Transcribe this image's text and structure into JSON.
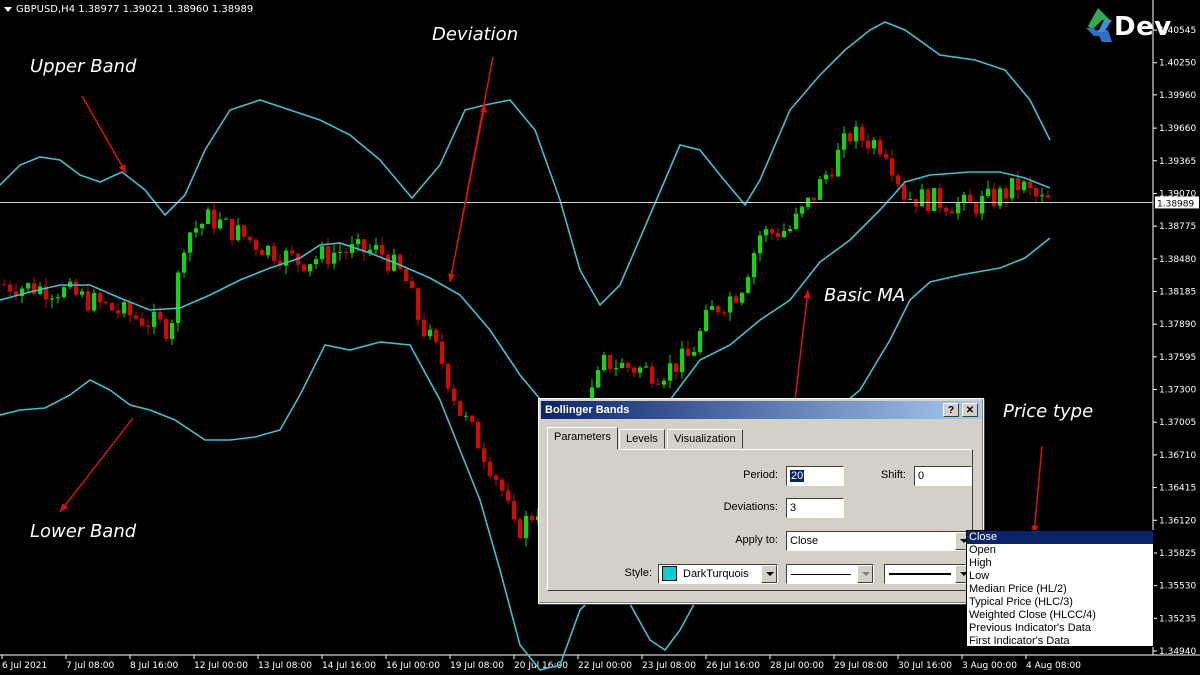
{
  "window": {
    "header": "GBPUSD,H4  1.38977 1.39021 1.38960 1.38989",
    "current_price": "1.38989"
  },
  "colors": {
    "background": "#000000",
    "bull_candle": "#00e000",
    "bear_candle": "#e00000",
    "band_line": "#3fc0d0",
    "arrow": "#e01010"
  },
  "logo": {
    "text": "Dev",
    "icon": "4x-logo-icon"
  },
  "annotations": {
    "upper_band": "Upper Band",
    "lower_band": "Lower Band",
    "deviation": "Deviation",
    "basic_ma": "Basic MA",
    "price_type": "Price type"
  },
  "chart_data": {
    "type": "candlestick",
    "symbol": "GBPUSD",
    "timeframe": "H4",
    "y_ticks": [
      "1.40545",
      "1.40250",
      "1.39960",
      "1.39660",
      "1.39365",
      "1.39070",
      "1.38775",
      "1.38480",
      "1.38185",
      "1.37890",
      "1.37595",
      "1.37300",
      "1.37005",
      "1.36710",
      "1.36415",
      "1.36120",
      "1.35825",
      "1.35530",
      "1.35235",
      "1.34940"
    ],
    "x_ticks": [
      "6 Jul 2021",
      "7 Jul 08:00",
      "8 Jul 16:00",
      "12 Jul 00:00",
      "13 Jul 08:00",
      "14 Jul 16:00",
      "16 Jul 00:00",
      "19 Jul 08:00",
      "20 Jul 16:00",
      "22 Jul 00:00",
      "23 Jul 08:00",
      "26 Jul 16:00",
      "28 Jul 00:00",
      "29 Jul 08:00",
      "30 Jul 16:00",
      "3 Aug 00:00",
      "4 Aug 08:00"
    ],
    "ylim": [
      1.3494,
      1.4069
    ],
    "current_price": 1.38989,
    "indicator": "Bollinger Bands",
    "period": 20,
    "deviations": 3
  },
  "dialog": {
    "title": "Bollinger Bands",
    "help_btn": "?",
    "close_btn": "✕",
    "tabs": [
      "Parameters",
      "Levels",
      "Visualization"
    ],
    "period_label": "Period:",
    "period_value": "20",
    "shift_label": "Shift:",
    "shift_value": "0",
    "deviations_label": "Deviations:",
    "deviations_value": "3",
    "apply_label": "Apply to:",
    "apply_value": "Close",
    "style_label": "Style:",
    "style_color": "DarkTurquois"
  },
  "apply_options": [
    "Close",
    "Open",
    "High",
    "Low",
    "Median Price (HL/2)",
    "Typical Price (HLC/3)",
    "Weighted Close (HLCC/4)",
    "Previous Indicator's Data",
    "First Indicator's Data"
  ]
}
